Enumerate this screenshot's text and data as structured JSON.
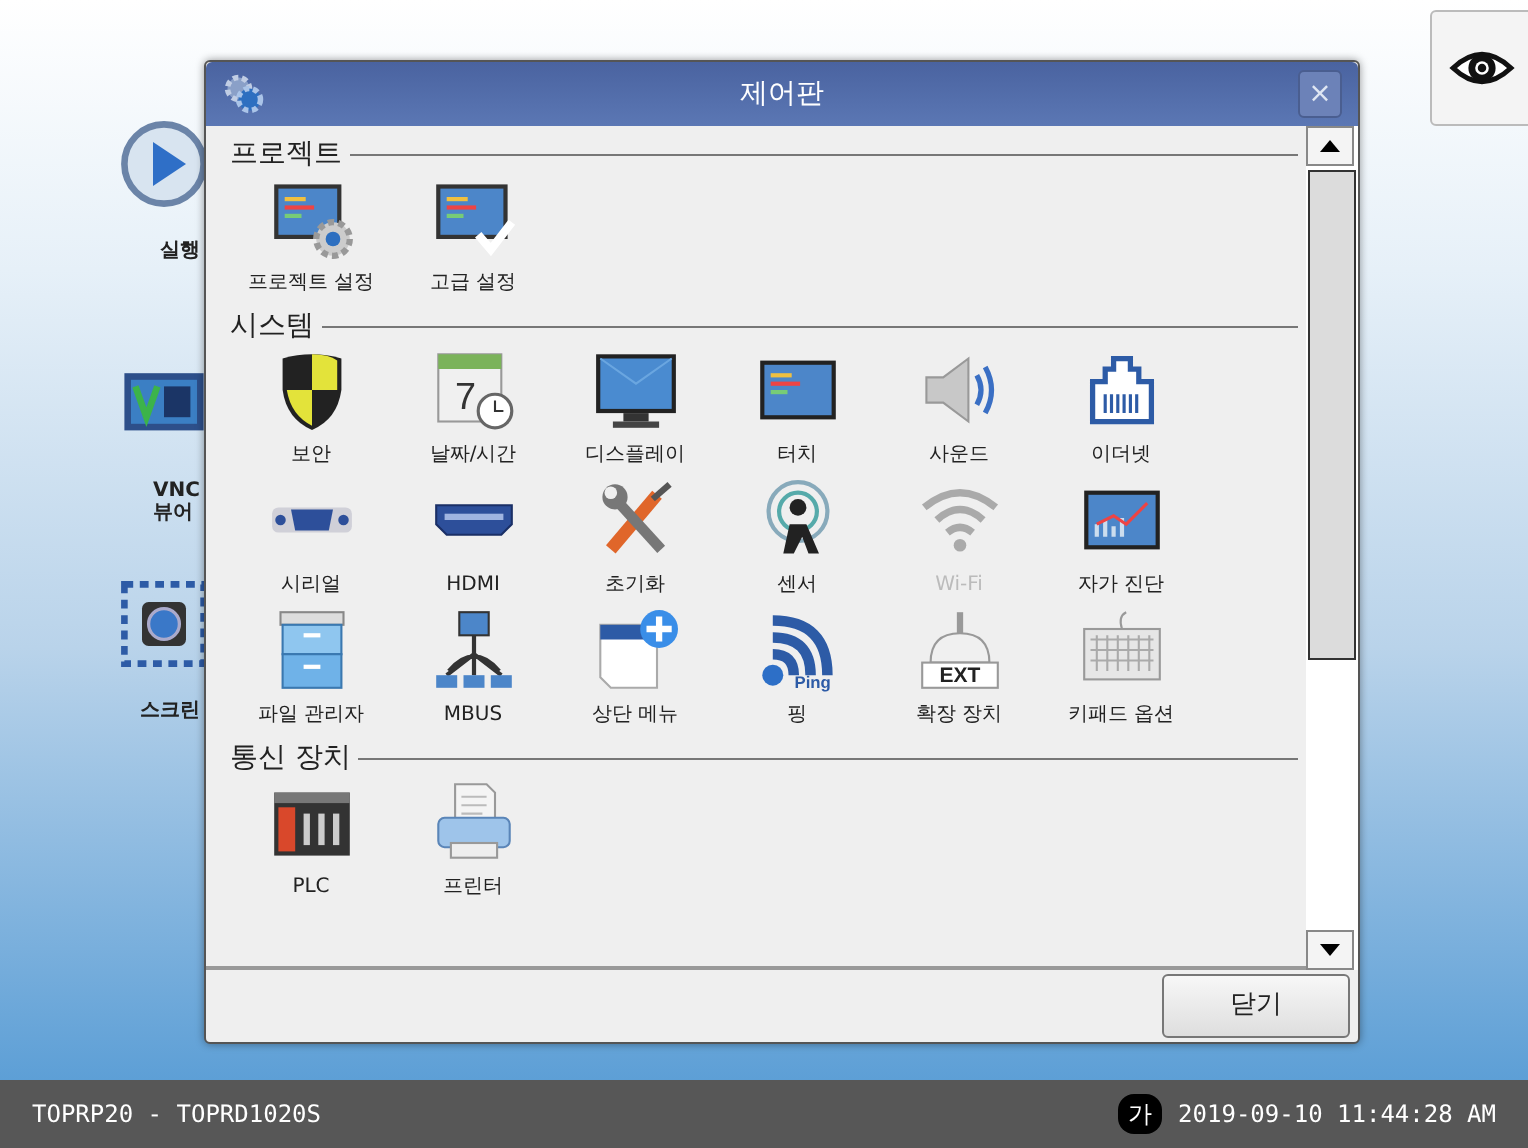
{
  "desktop": {
    "shortcuts": [
      {
        "label": "실행"
      },
      {
        "label": "VNC 뷰어"
      },
      {
        "label": "스크린"
      }
    ]
  },
  "dialog": {
    "title": "제어판",
    "close": "×",
    "sections": [
      {
        "title": "프로젝트",
        "items": [
          {
            "label": "프로젝트 설정",
            "disabled": false
          },
          {
            "label": "고급 설정",
            "disabled": false
          }
        ]
      },
      {
        "title": "시스템",
        "items": [
          {
            "label": "보안",
            "disabled": false
          },
          {
            "label": "날짜/시간",
            "icon_text": "7",
            "disabled": false
          },
          {
            "label": "디스플레이",
            "disabled": false
          },
          {
            "label": "터치",
            "disabled": false
          },
          {
            "label": "사운드",
            "disabled": false
          },
          {
            "label": "이더넷",
            "disabled": false
          },
          {
            "label": "시리얼",
            "disabled": false
          },
          {
            "label": "HDMI",
            "disabled": false
          },
          {
            "label": "초기화",
            "disabled": false
          },
          {
            "label": "센서",
            "disabled": false
          },
          {
            "label": "Wi-Fi",
            "disabled": true
          },
          {
            "label": "자가 진단",
            "disabled": false
          },
          {
            "label": "파일 관리자",
            "disabled": false
          },
          {
            "label": "MBUS",
            "disabled": false
          },
          {
            "label": "상단 메뉴",
            "disabled": false
          },
          {
            "label": "핑",
            "icon_text": "Ping",
            "disabled": false
          },
          {
            "label": "확장 장치",
            "icon_text": "EXT",
            "disabled": false
          },
          {
            "label": "키패드 옵션",
            "disabled": false
          }
        ]
      },
      {
        "title": "통신 장치",
        "items": [
          {
            "label": "PLC",
            "disabled": false
          },
          {
            "label": "프린터",
            "disabled": false
          }
        ]
      }
    ],
    "close_button": "닫기"
  },
  "taskbar": {
    "title": "TOPRP20 - TOPRD1020S",
    "ime": "가",
    "datetime": "2019-09-10 11:44:28 AM"
  }
}
